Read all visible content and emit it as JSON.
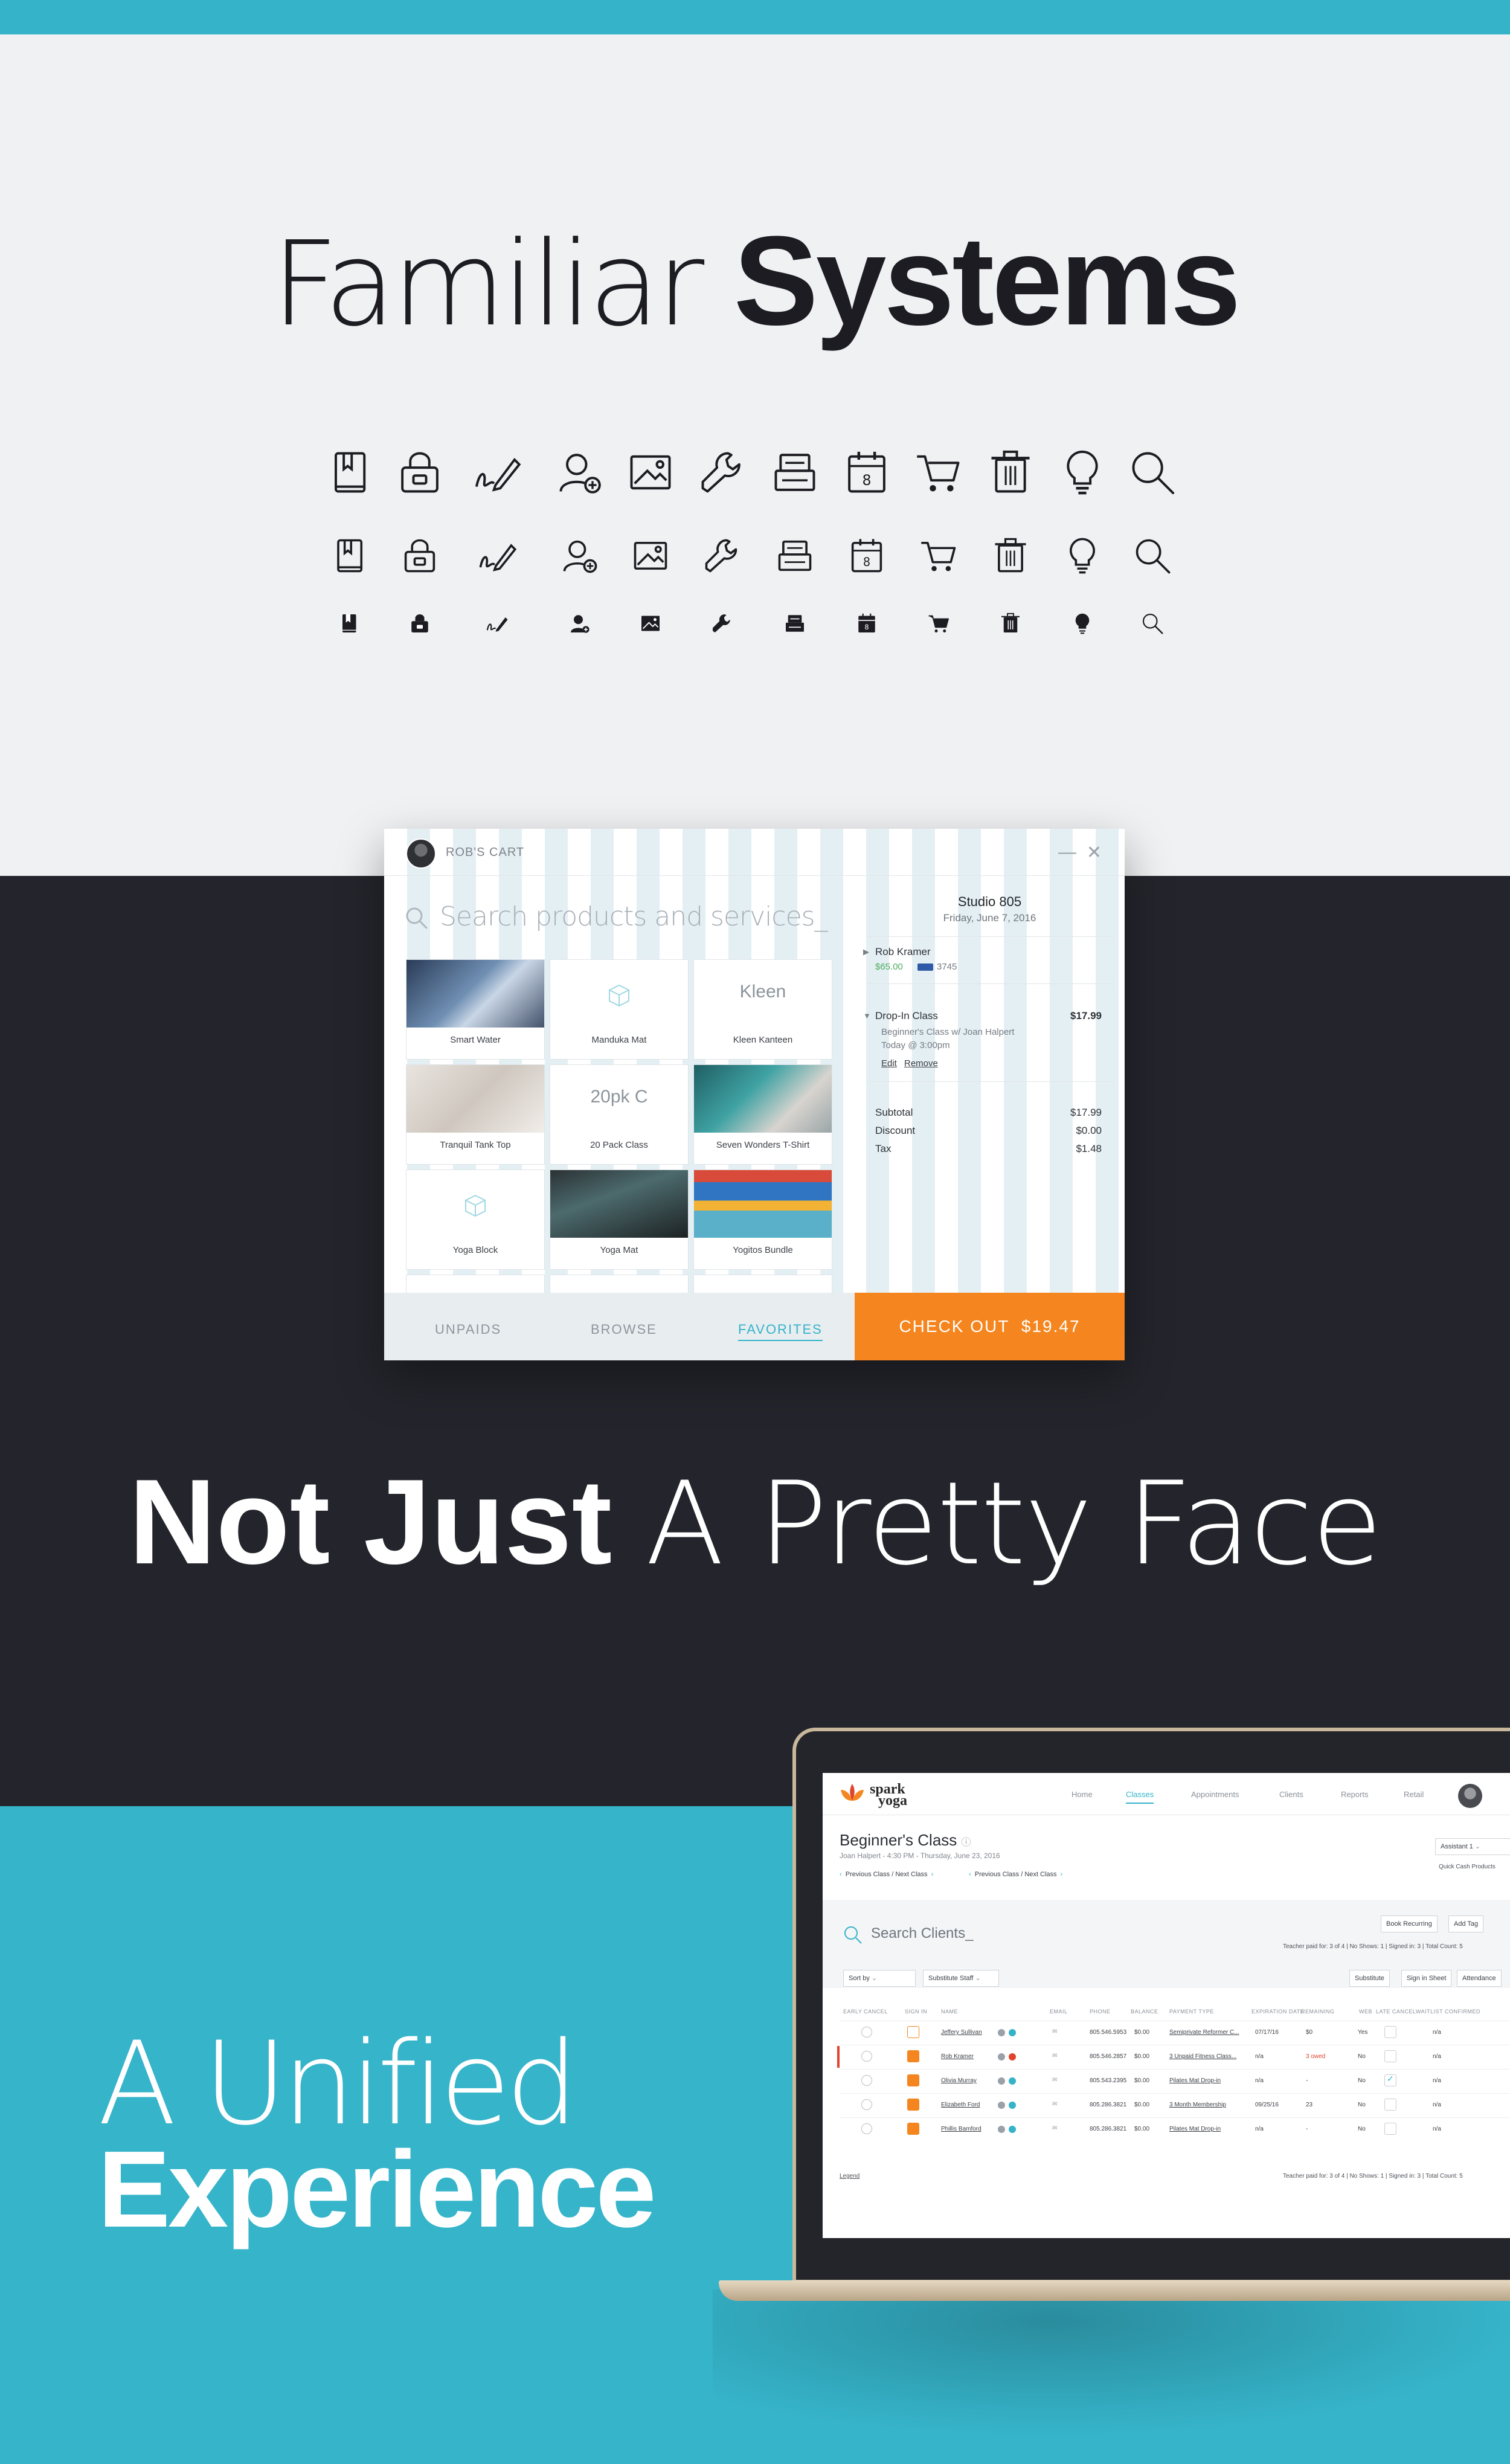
{
  "section1": {
    "headline_light": "Familiar",
    "headline_bold": "Systems"
  },
  "icons": [
    "bookmark-book-icon",
    "wallet-lock-icon",
    "signature-pen-icon",
    "add-user-icon",
    "image-icon",
    "wrench-icon",
    "register-icon",
    "calendar-icon",
    "cart-icon",
    "trash-icon",
    "lightbulb-icon",
    "search-icon"
  ],
  "cart": {
    "owner": "ROB'S CART",
    "search_placeholder": "Search products and services_",
    "products": [
      {
        "label": "Smart Water",
        "thumb": "photo",
        "text": ""
      },
      {
        "label": "Manduka Mat",
        "thumb": "icon",
        "text": ""
      },
      {
        "label": "Kleen Kanteen",
        "thumb": "text",
        "text": "Kleen"
      },
      {
        "label": "Tranquil Tank Top",
        "thumb": "photo",
        "text": ""
      },
      {
        "label": "20 Pack Class",
        "thumb": "text",
        "text": "20pk C"
      },
      {
        "label": "Seven Wonders T-Shirt",
        "thumb": "photo",
        "text": ""
      },
      {
        "label": "Yoga Block",
        "thumb": "icon",
        "text": ""
      },
      {
        "label": "Yoga Mat",
        "thumb": "photo",
        "text": ""
      },
      {
        "label": "Yogitos Bundle",
        "thumb": "photo",
        "text": ""
      }
    ],
    "tabs": {
      "unpaids": "UNPAIDS",
      "browse": "BROWSE",
      "favorites": "FAVORITES"
    },
    "studio": "Studio 805",
    "date": "Friday, June 7, 2016",
    "client": {
      "name": "Rob Kramer",
      "balance": "$65.00",
      "card": "3745"
    },
    "item": {
      "name": "Drop-In Class",
      "price": "$17.99",
      "detail1": "Beginner's Class w/ Joan Halpert",
      "detail2": "Today @ 3:00pm",
      "edit": "Edit",
      "remove": "Remove"
    },
    "totals": {
      "subtotal_label": "Subtotal",
      "subtotal": "$17.99",
      "discount_label": "Discount",
      "discount": "$0.00",
      "tax_label": "Tax",
      "tax": "$1.48"
    },
    "checkout_label": "CHECK OUT",
    "checkout_amount": "$19.47"
  },
  "section2": {
    "headline_bold": "Not Just",
    "headline_light": "A Pretty Face"
  },
  "section3": {
    "headline_light": "A Unified",
    "headline_bold": "Experience"
  },
  "app": {
    "logo_line1": "spark",
    "logo_line2": "yoga",
    "nav": {
      "home": "Home",
      "classes": "Classes",
      "appointments": "Appointments",
      "clients": "Clients",
      "reports": "Reports",
      "retail": "Retail"
    },
    "class_title": "Beginner's Class",
    "class_sub": "Joan Halpert - 4:30 PM - Thursday, June 23, 2016",
    "prev_next_1": "Previous Class / Next Class",
    "prev_next_2": "Previous Class / Next Class",
    "assistant": "Assistant 1",
    "quick_cash": "Quick Cash Products",
    "search_placeholder": "Search Clients_",
    "book_recurring": "Book Recurring",
    "add_tag": "Add Tag",
    "summary": "Teacher paid for: 3 of 4  |  No Shows: 1  |  Signed in: 3  |  Total Count: 5",
    "sort_by": "Sort by",
    "substitute_staff": "Substitute Staff",
    "substitute": "Substitute",
    "sign_in_sheet": "Sign in Sheet",
    "attendance": "Attendance",
    "headers": {
      "early_cancel": "EARLY CANCEL",
      "sign_in": "SIGN IN",
      "name": "NAME",
      "email": "EMAIL",
      "phone": "PHONE",
      "balance": "BALANCE",
      "payment_type": "PAYMENT TYPE",
      "expiration": "EXPIRATION DATE",
      "remaining": "REMAINING",
      "web": "WEB",
      "late_cancel": "LATE CANCEL",
      "waitlist": "WAITLIST CONFIRMED"
    },
    "rows": [
      {
        "name": "Jeffery Sullivan",
        "phone": "805.546.5953",
        "balance": "$0.00",
        "payment": "Semiprivate Reformer C...",
        "expiration": "07/17/16",
        "remaining": "$0",
        "web": "Yes",
        "waitlist": "n/a"
      },
      {
        "name": "Rob Kramer",
        "phone": "805.546.2857",
        "balance": "$0.00",
        "payment": "3 Unpaid Fitness Class...",
        "expiration": "n/a",
        "remaining": "3 owed",
        "web": "No",
        "waitlist": "n/a"
      },
      {
        "name": "Olivia Murray",
        "phone": "805.543.2395",
        "balance": "$0.00",
        "payment": "Pilates Mat Drop-in",
        "expiration": "n/a",
        "remaining": "-",
        "web": "No",
        "waitlist": "n/a"
      },
      {
        "name": "Elizabeth Ford",
        "phone": "805.286.3821",
        "balance": "$0.00",
        "payment": "3 Month Membership",
        "expiration": "09/25/16",
        "remaining": "23",
        "web": "No",
        "waitlist": "n/a"
      },
      {
        "name": "Phillis Bamford",
        "phone": "805.286.3821",
        "balance": "$0.00",
        "payment": "Pilates Mat Drop-in",
        "expiration": "n/a",
        "remaining": "-",
        "web": "No",
        "waitlist": "n/a"
      }
    ],
    "legend": "Legend",
    "footer_summary": "Teacher paid for: 3 of 4  |  No Shows: 1  |  Signed in: 3  |  Total Count: 5"
  },
  "colors": {
    "accent": "#35b3c9",
    "orange": "#f5861f",
    "dark": "#24252c",
    "light_bg": "#f0f1f3"
  }
}
